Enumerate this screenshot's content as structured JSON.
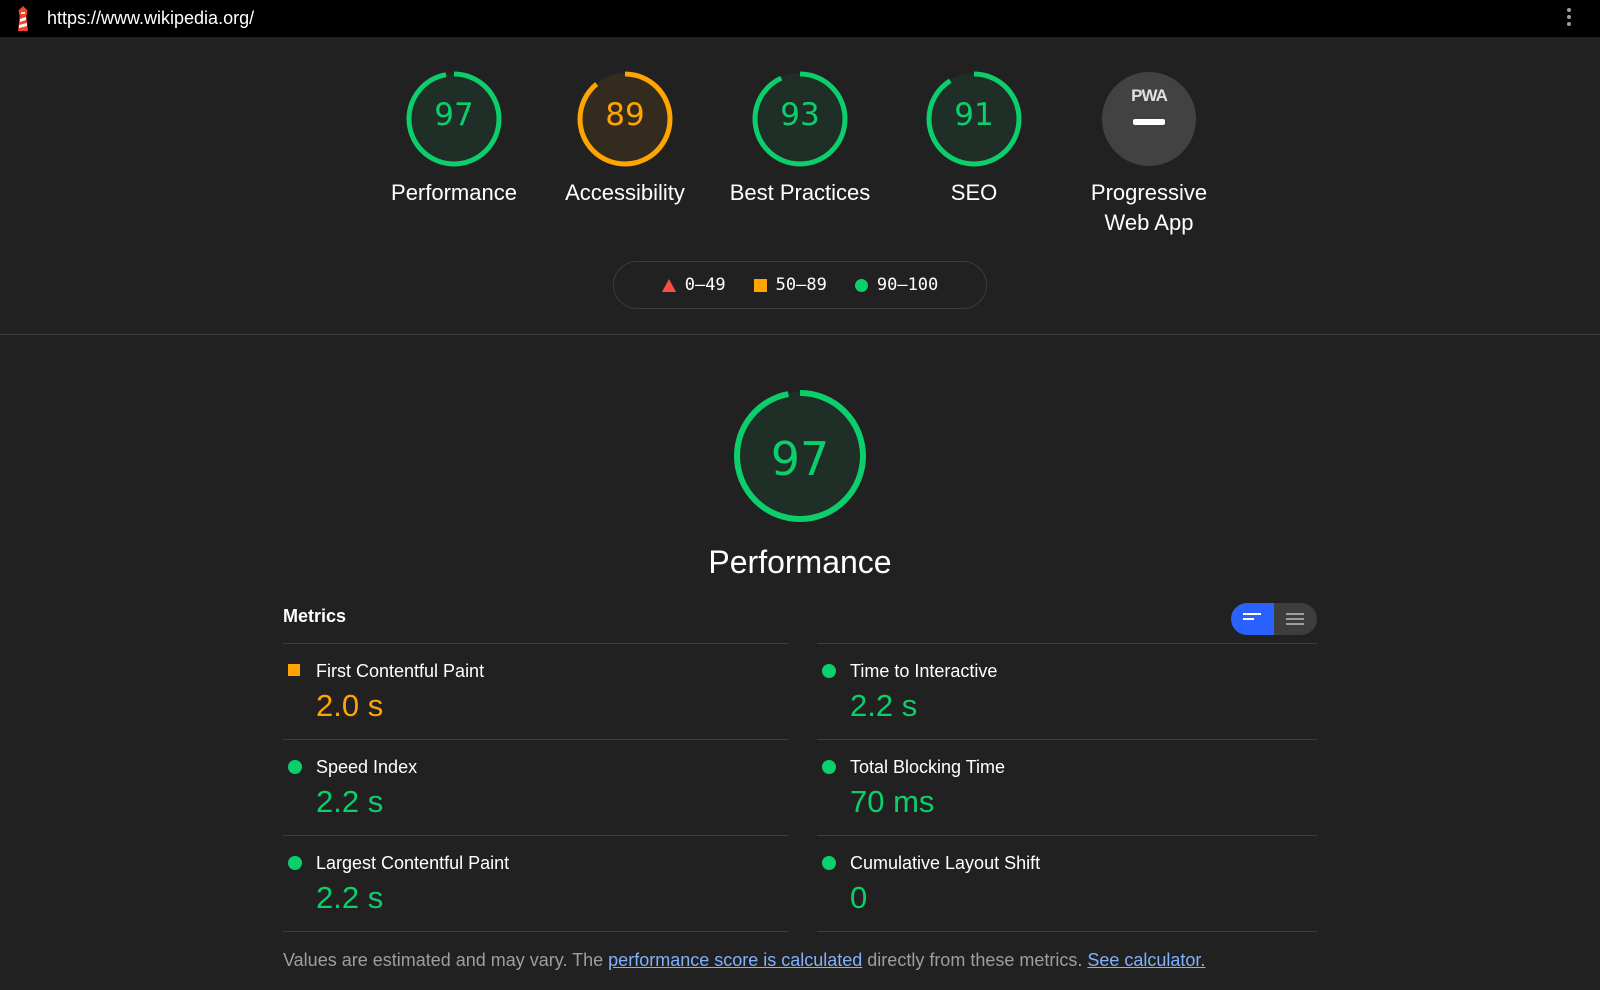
{
  "browser": {
    "url": "https://www.wikipedia.org/",
    "logo_icon": "lighthouse-icon",
    "menu_icon": "kebab-menu-icon"
  },
  "colors": {
    "pass": "#0cce6b",
    "average": "#ffa400",
    "fail": "#ff4e42",
    "background": "#212121",
    "link": "#82b1ff"
  },
  "categories": [
    {
      "label": "Performance",
      "score": "97",
      "rating": "pass"
    },
    {
      "label": "Accessibility",
      "score": "89",
      "rating": "average"
    },
    {
      "label": "Best Practices",
      "score": "93",
      "rating": "pass"
    },
    {
      "label": "SEO",
      "score": "91",
      "rating": "pass"
    },
    {
      "label_line1": "Progressive",
      "label_line2": "Web App",
      "badge": "PWA",
      "icon": "pwa-badge-icon"
    }
  ],
  "legend": [
    {
      "range": "0–49",
      "icon": "triangle-icon",
      "rating": "fail"
    },
    {
      "range": "50–89",
      "icon": "square-icon",
      "rating": "average"
    },
    {
      "range": "90–100",
      "icon": "circle-icon",
      "rating": "pass"
    }
  ],
  "performance": {
    "score": "97",
    "title": "Performance"
  },
  "metrics": {
    "header": "Metrics",
    "view_toggle": {
      "active": "compact-view",
      "options": [
        "compact-view-icon",
        "expanded-view-icon"
      ]
    },
    "left": [
      {
        "label": "First Contentful Paint",
        "value": "2.0 s",
        "rating": "average"
      },
      {
        "label": "Speed Index",
        "value": "2.2 s",
        "rating": "pass"
      },
      {
        "label": "Largest Contentful Paint",
        "value": "2.2 s",
        "rating": "pass"
      }
    ],
    "right": [
      {
        "label": "Time to Interactive",
        "value": "2.2 s",
        "rating": "pass"
      },
      {
        "label": "Total Blocking Time",
        "value": "70 ms",
        "rating": "pass"
      },
      {
        "label": "Cumulative Layout Shift",
        "value": "0",
        "rating": "pass"
      }
    ]
  },
  "footnote": {
    "text1": "Values are estimated and may vary. The ",
    "link1": "performance score is calculated",
    "text2": " directly from these metrics. ",
    "link2": "See calculator."
  }
}
